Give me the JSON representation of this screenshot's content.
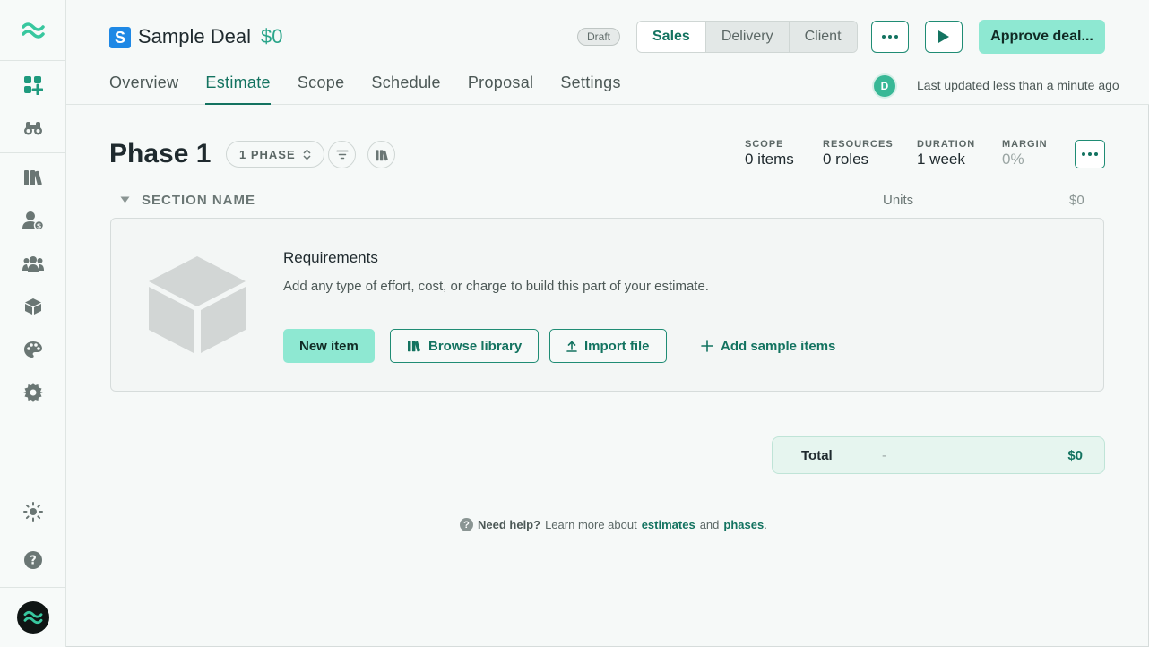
{
  "deal": {
    "badge_letter": "S",
    "title": "Sample Deal",
    "amount": "$0",
    "status": "Draft"
  },
  "views": [
    "Sales",
    "Delivery",
    "Client"
  ],
  "approve_label": "Approve deal...",
  "tabs": [
    "Overview",
    "Estimate",
    "Scope",
    "Schedule",
    "Proposal",
    "Settings"
  ],
  "active_tab": "Estimate",
  "user_initial": "D",
  "last_updated": "Last updated less than a minute ago",
  "phase": {
    "title": "Phase 1",
    "selector_label": "1 PHASE",
    "stats": [
      {
        "label": "SCOPE",
        "value": "0 items"
      },
      {
        "label": "RESOURCES",
        "value": "0 roles"
      },
      {
        "label": "DURATION",
        "value": "1 week"
      },
      {
        "label": "MARGIN",
        "value": "0%"
      }
    ]
  },
  "section": {
    "name": "SECTION NAME",
    "units_label": "Units",
    "total": "$0"
  },
  "empty_state": {
    "title": "Requirements",
    "description": "Add any type of effort, cost, or charge to build this part of your estimate.",
    "new_item": "New item",
    "browse_library": "Browse library",
    "import_file": "Import file",
    "add_sample": "Add sample items"
  },
  "total": {
    "label": "Total",
    "dash": "-",
    "value": "$0"
  },
  "help": {
    "lead": "Need help?",
    "text1": "Learn more about",
    "link1": "estimates",
    "text2": "and",
    "link2": "phases",
    "end": "."
  },
  "colors": {
    "accent": "#137360",
    "primary_button": "#8ee8d2",
    "deal_badge": "#1e88e5"
  }
}
